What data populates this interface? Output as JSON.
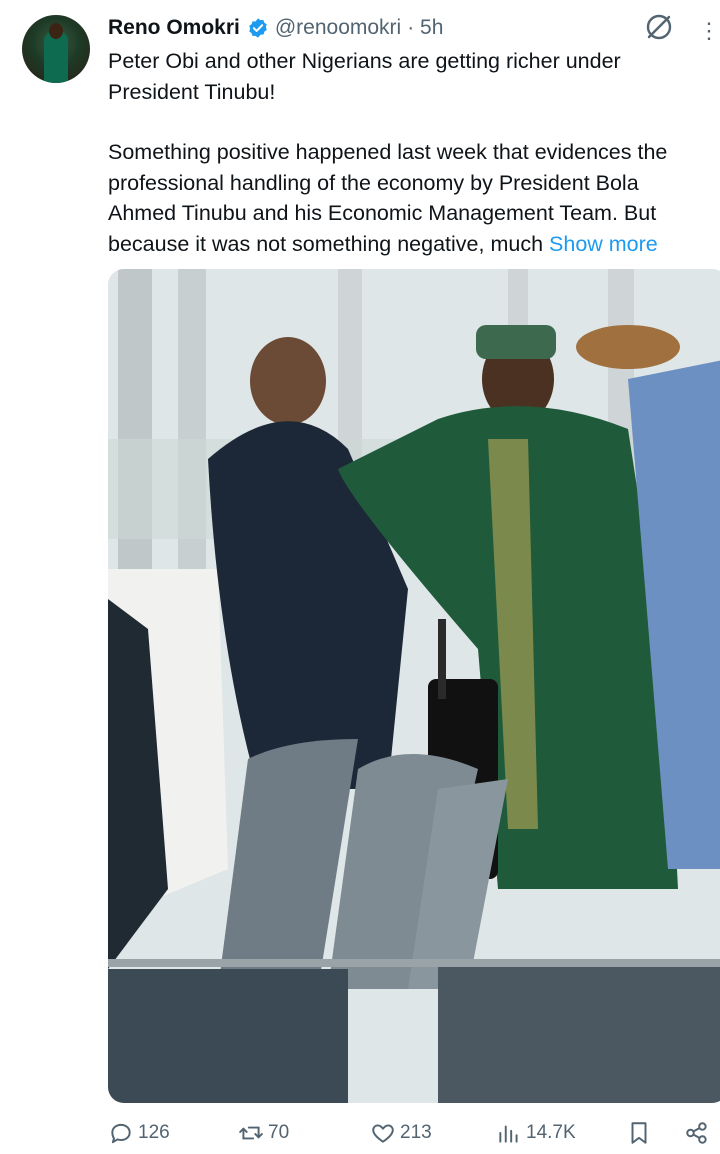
{
  "tweet": {
    "author_name": "Reno Omokri",
    "handle": "@renoomokri",
    "time": "· 5h",
    "line1": "Peter Obi and other Nigerians are getting richer under",
    "line2": "President Tinubu!",
    "line3": "Something positive happened last week that evidences the",
    "line4": "professional handling of the economy by President Bola",
    "line5": "Ahmed Tinubu and his Economic Management Team. But",
    "line6": "because it was not something negative, much ",
    "show_more": "Show more"
  },
  "stats": {
    "replies": "126",
    "reposts": "70",
    "likes": "213",
    "views": "14.7K"
  },
  "icons": {
    "avatar": "avatar",
    "verified": "verified-badge-icon",
    "grok": "grok-icon",
    "more": "more-icon",
    "reply": "reply-icon",
    "repost": "repost-icon",
    "like": "heart-icon",
    "views": "views-icon",
    "bookmark": "bookmark-icon",
    "share": "share-icon"
  },
  "colors": {
    "link": "#1d9bf0",
    "secondary": "#536471",
    "verified": "#1d9bf0"
  }
}
